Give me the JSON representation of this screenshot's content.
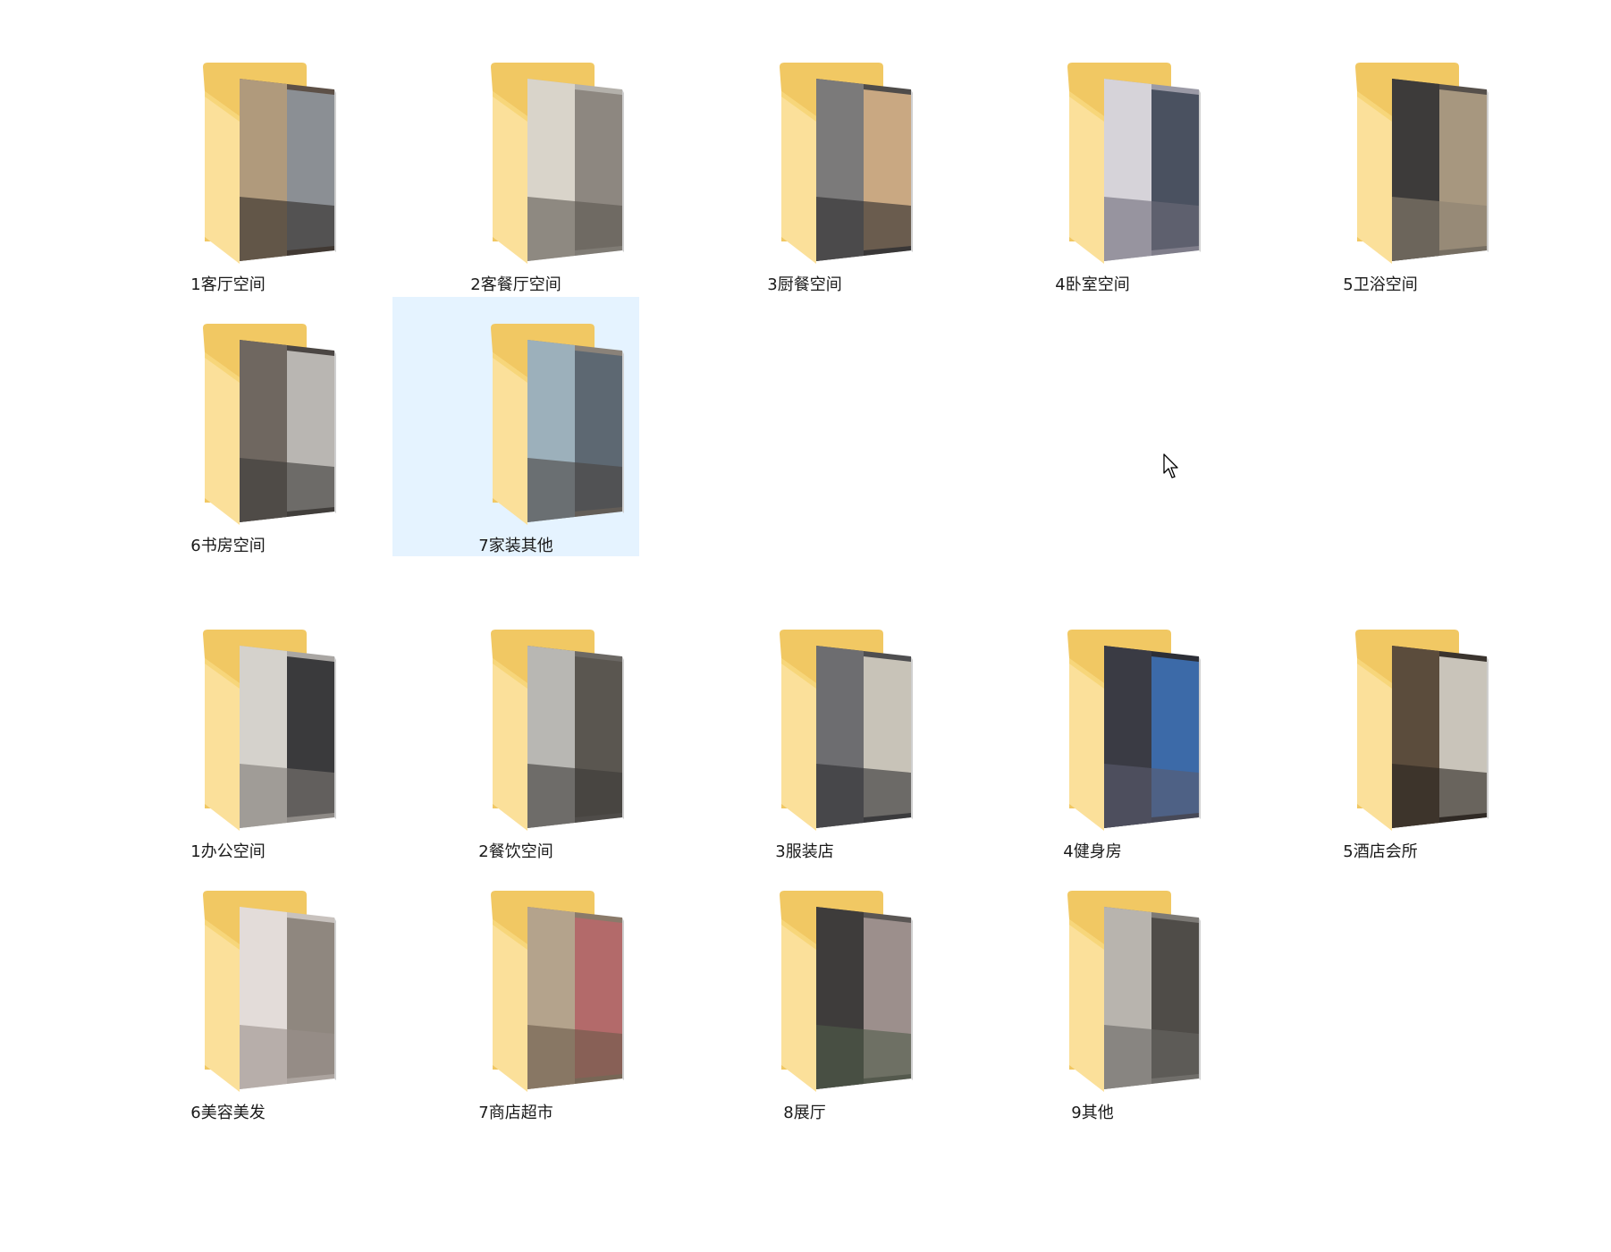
{
  "groups": [
    {
      "items": [
        {
          "label": "1客厅空间",
          "icon": "folder-icon",
          "selected": false
        },
        {
          "label": "2客餐厅空间",
          "icon": "folder-icon",
          "selected": false
        },
        {
          "label": "3厨餐空间",
          "icon": "folder-icon",
          "selected": false
        },
        {
          "label": "4卧室空间",
          "icon": "folder-icon",
          "selected": false
        },
        {
          "label": "5卫浴空间",
          "icon": "folder-icon",
          "selected": false
        },
        {
          "label": "6书房空间",
          "icon": "folder-icon",
          "selected": false
        },
        {
          "label": "7家装其他",
          "icon": "folder-icon",
          "selected": true
        }
      ]
    },
    {
      "items": [
        {
          "label": "1办公空间",
          "icon": "folder-icon",
          "selected": false
        },
        {
          "label": "2餐饮空间",
          "icon": "folder-icon",
          "selected": false
        },
        {
          "label": "3服装店",
          "icon": "folder-icon",
          "selected": false
        },
        {
          "label": "4健身房",
          "icon": "folder-icon",
          "selected": false
        },
        {
          "label": "5酒店会所",
          "icon": "folder-icon",
          "selected": false
        },
        {
          "label": "6美容美发",
          "icon": "folder-icon",
          "selected": false
        },
        {
          "label": "7商店超市",
          "icon": "folder-icon",
          "selected": false
        },
        {
          "label": "8展厅",
          "icon": "folder-icon",
          "selected": false
        },
        {
          "label": "9其他",
          "icon": "folder-icon",
          "selected": false
        }
      ]
    }
  ],
  "colors": {
    "selection": "#e5f3ff",
    "folder_back": "#f3cd6a",
    "folder_front": "#fbe098"
  }
}
